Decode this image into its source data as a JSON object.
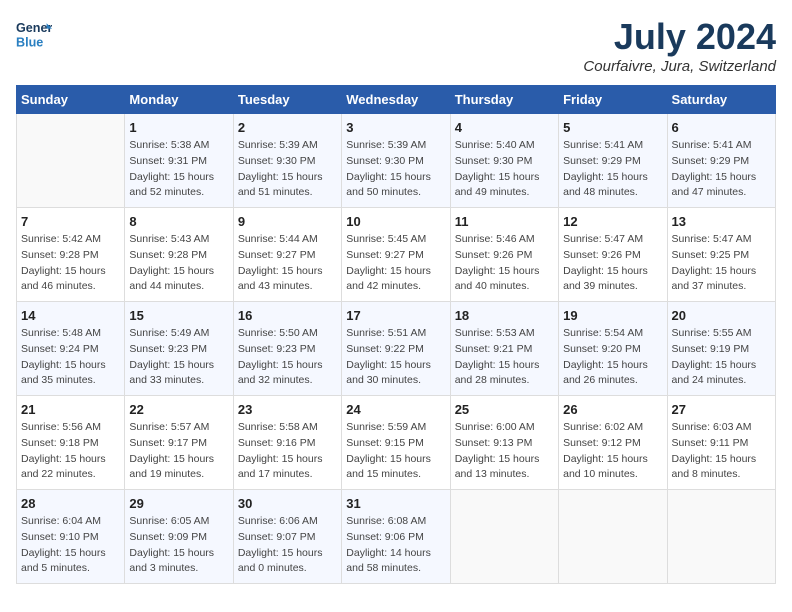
{
  "header": {
    "logo_line1": "General",
    "logo_line2": "Blue",
    "month_year": "July 2024",
    "location": "Courfaivre, Jura, Switzerland"
  },
  "weekdays": [
    "Sunday",
    "Monday",
    "Tuesday",
    "Wednesday",
    "Thursday",
    "Friday",
    "Saturday"
  ],
  "weeks": [
    [
      {
        "day": "",
        "info": ""
      },
      {
        "day": "1",
        "info": "Sunrise: 5:38 AM\nSunset: 9:31 PM\nDaylight: 15 hours\nand 52 minutes."
      },
      {
        "day": "2",
        "info": "Sunrise: 5:39 AM\nSunset: 9:30 PM\nDaylight: 15 hours\nand 51 minutes."
      },
      {
        "day": "3",
        "info": "Sunrise: 5:39 AM\nSunset: 9:30 PM\nDaylight: 15 hours\nand 50 minutes."
      },
      {
        "day": "4",
        "info": "Sunrise: 5:40 AM\nSunset: 9:30 PM\nDaylight: 15 hours\nand 49 minutes."
      },
      {
        "day": "5",
        "info": "Sunrise: 5:41 AM\nSunset: 9:29 PM\nDaylight: 15 hours\nand 48 minutes."
      },
      {
        "day": "6",
        "info": "Sunrise: 5:41 AM\nSunset: 9:29 PM\nDaylight: 15 hours\nand 47 minutes."
      }
    ],
    [
      {
        "day": "7",
        "info": "Sunrise: 5:42 AM\nSunset: 9:28 PM\nDaylight: 15 hours\nand 46 minutes."
      },
      {
        "day": "8",
        "info": "Sunrise: 5:43 AM\nSunset: 9:28 PM\nDaylight: 15 hours\nand 44 minutes."
      },
      {
        "day": "9",
        "info": "Sunrise: 5:44 AM\nSunset: 9:27 PM\nDaylight: 15 hours\nand 43 minutes."
      },
      {
        "day": "10",
        "info": "Sunrise: 5:45 AM\nSunset: 9:27 PM\nDaylight: 15 hours\nand 42 minutes."
      },
      {
        "day": "11",
        "info": "Sunrise: 5:46 AM\nSunset: 9:26 PM\nDaylight: 15 hours\nand 40 minutes."
      },
      {
        "day": "12",
        "info": "Sunrise: 5:47 AM\nSunset: 9:26 PM\nDaylight: 15 hours\nand 39 minutes."
      },
      {
        "day": "13",
        "info": "Sunrise: 5:47 AM\nSunset: 9:25 PM\nDaylight: 15 hours\nand 37 minutes."
      }
    ],
    [
      {
        "day": "14",
        "info": "Sunrise: 5:48 AM\nSunset: 9:24 PM\nDaylight: 15 hours\nand 35 minutes."
      },
      {
        "day": "15",
        "info": "Sunrise: 5:49 AM\nSunset: 9:23 PM\nDaylight: 15 hours\nand 33 minutes."
      },
      {
        "day": "16",
        "info": "Sunrise: 5:50 AM\nSunset: 9:23 PM\nDaylight: 15 hours\nand 32 minutes."
      },
      {
        "day": "17",
        "info": "Sunrise: 5:51 AM\nSunset: 9:22 PM\nDaylight: 15 hours\nand 30 minutes."
      },
      {
        "day": "18",
        "info": "Sunrise: 5:53 AM\nSunset: 9:21 PM\nDaylight: 15 hours\nand 28 minutes."
      },
      {
        "day": "19",
        "info": "Sunrise: 5:54 AM\nSunset: 9:20 PM\nDaylight: 15 hours\nand 26 minutes."
      },
      {
        "day": "20",
        "info": "Sunrise: 5:55 AM\nSunset: 9:19 PM\nDaylight: 15 hours\nand 24 minutes."
      }
    ],
    [
      {
        "day": "21",
        "info": "Sunrise: 5:56 AM\nSunset: 9:18 PM\nDaylight: 15 hours\nand 22 minutes."
      },
      {
        "day": "22",
        "info": "Sunrise: 5:57 AM\nSunset: 9:17 PM\nDaylight: 15 hours\nand 19 minutes."
      },
      {
        "day": "23",
        "info": "Sunrise: 5:58 AM\nSunset: 9:16 PM\nDaylight: 15 hours\nand 17 minutes."
      },
      {
        "day": "24",
        "info": "Sunrise: 5:59 AM\nSunset: 9:15 PM\nDaylight: 15 hours\nand 15 minutes."
      },
      {
        "day": "25",
        "info": "Sunrise: 6:00 AM\nSunset: 9:13 PM\nDaylight: 15 hours\nand 13 minutes."
      },
      {
        "day": "26",
        "info": "Sunrise: 6:02 AM\nSunset: 9:12 PM\nDaylight: 15 hours\nand 10 minutes."
      },
      {
        "day": "27",
        "info": "Sunrise: 6:03 AM\nSunset: 9:11 PM\nDaylight: 15 hours\nand 8 minutes."
      }
    ],
    [
      {
        "day": "28",
        "info": "Sunrise: 6:04 AM\nSunset: 9:10 PM\nDaylight: 15 hours\nand 5 minutes."
      },
      {
        "day": "29",
        "info": "Sunrise: 6:05 AM\nSunset: 9:09 PM\nDaylight: 15 hours\nand 3 minutes."
      },
      {
        "day": "30",
        "info": "Sunrise: 6:06 AM\nSunset: 9:07 PM\nDaylight: 15 hours\nand 0 minutes."
      },
      {
        "day": "31",
        "info": "Sunrise: 6:08 AM\nSunset: 9:06 PM\nDaylight: 14 hours\nand 58 minutes."
      },
      {
        "day": "",
        "info": ""
      },
      {
        "day": "",
        "info": ""
      },
      {
        "day": "",
        "info": ""
      }
    ]
  ]
}
